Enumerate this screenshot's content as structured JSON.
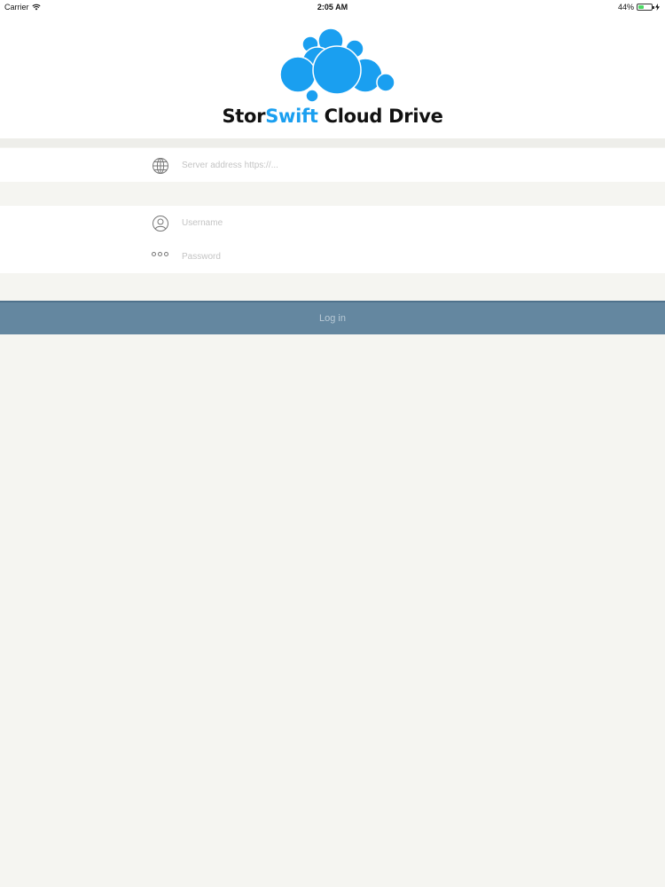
{
  "status_bar": {
    "carrier": "Carrier",
    "time": "2:05 AM",
    "battery_percent": "44%",
    "battery_level": 0.44
  },
  "header": {
    "brand_part1": "Stor",
    "brand_part2": "Swift",
    "brand_part3": " Cloud Drive",
    "brand_color": "#1a9ff0",
    "logo_color": "#1a9ff0"
  },
  "form": {
    "server_placeholder": "Server address https://...",
    "server_icon": "globe-icon",
    "username_placeholder": "Username",
    "username_icon": "user-icon",
    "password_placeholder": "Password",
    "password_icon": "password-dots-icon",
    "login_label": "Log in",
    "login_color": "#6487a0"
  }
}
